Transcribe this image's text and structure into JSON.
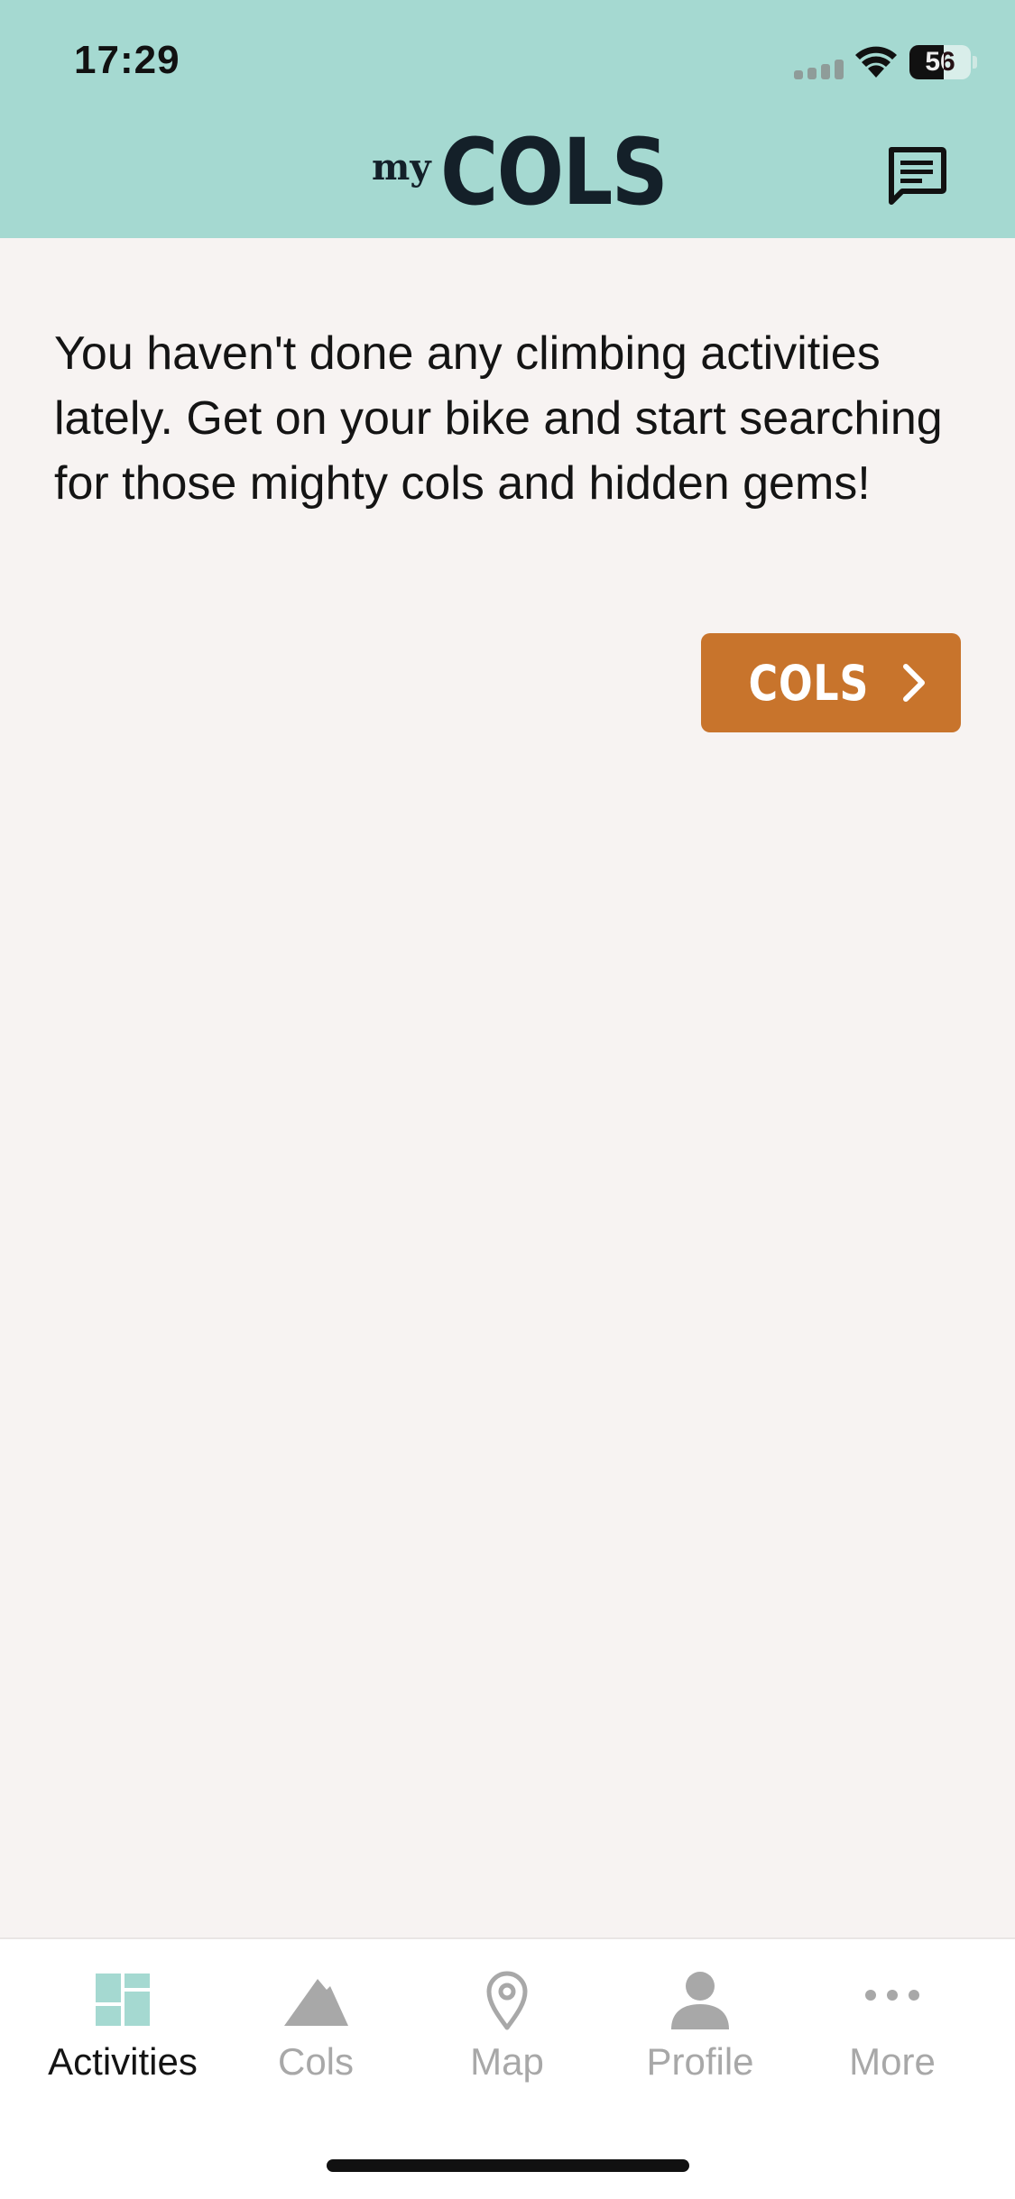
{
  "status_bar": {
    "time": "17:29",
    "battery_level": "56",
    "battery_fraction": 0.56,
    "signal_icon": "cellular-signal-icon",
    "wifi_icon": "wifi-icon"
  },
  "header": {
    "logo_prefix": "my",
    "logo_main": "COLS",
    "chat_icon": "message-icon",
    "background_color": "#a5d9d1"
  },
  "main": {
    "empty_message": "You haven't done any climbing activities lately. Get on your bike and start searching for those mighty cols and hidden gems!",
    "cta_label": "COLS",
    "cta_icon": "chevron-right-icon",
    "cta_color": "#c8742c"
  },
  "tab_bar": {
    "active_color": "#a5d9d1",
    "inactive_color": "#a8a8a8",
    "tabs": [
      {
        "label": "Activities",
        "icon": "dashboard-icon",
        "active": true
      },
      {
        "label": "Cols",
        "icon": "mountain-icon",
        "active": false
      },
      {
        "label": "Map",
        "icon": "map-pin-icon",
        "active": false
      },
      {
        "label": "Profile",
        "icon": "person-icon",
        "active": false
      },
      {
        "label": "More",
        "icon": "more-dots-icon",
        "active": false
      }
    ]
  }
}
